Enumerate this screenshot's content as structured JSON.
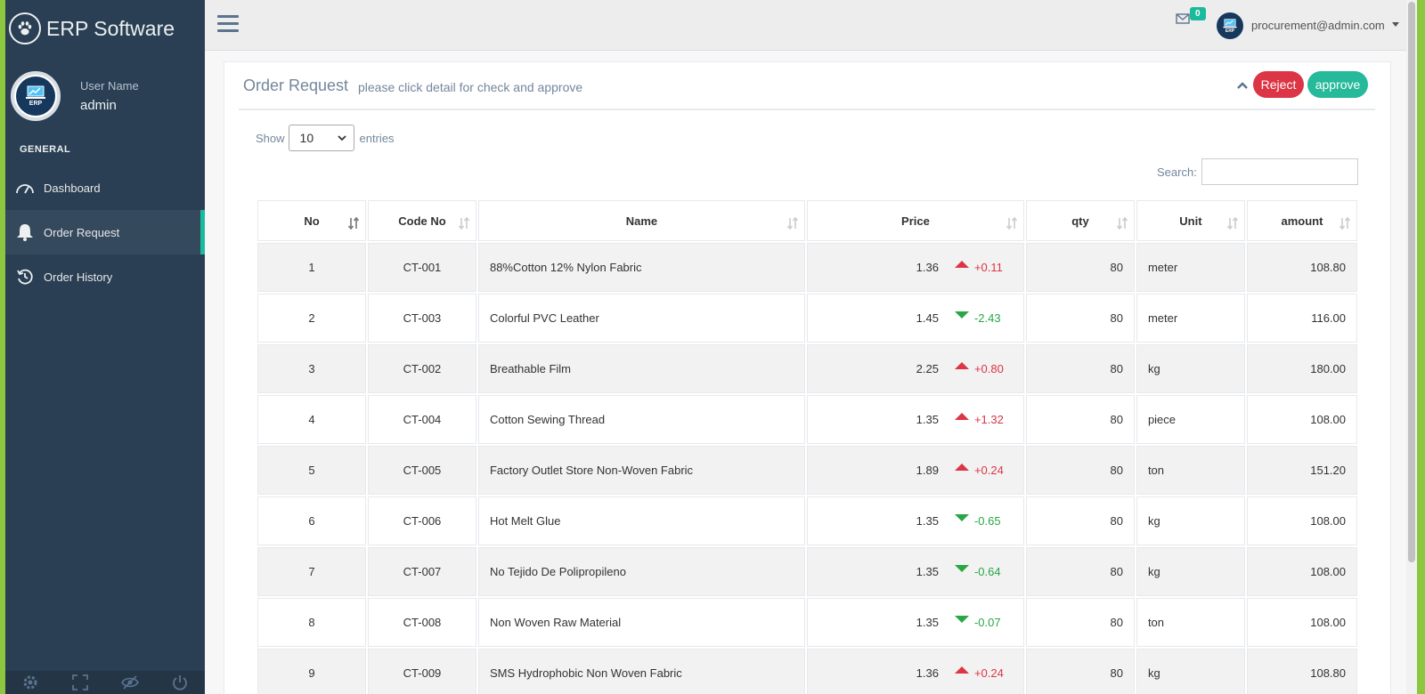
{
  "brand": {
    "title": "ERP Software",
    "icon": "paw-icon"
  },
  "profile": {
    "label": "User Name",
    "name": "admin",
    "avatar_text": "ERP"
  },
  "sidebar": {
    "section": "GENERAL",
    "items": [
      {
        "label": "Dashboard",
        "icon": "speedometer-icon",
        "active": false
      },
      {
        "label": "Order Request",
        "icon": "bell-icon",
        "active": true
      },
      {
        "label": "Order History",
        "icon": "history-icon",
        "active": false
      }
    ],
    "footer_icons": [
      "settings-icon",
      "fullscreen-icon",
      "lock-icon",
      "logout-icon"
    ]
  },
  "topnav": {
    "mail_count": "0",
    "user_email": "procurement@admin.com",
    "avatar_text": "ERP"
  },
  "panel": {
    "title": "Order Request",
    "subtitle": "please click detail for check and approve",
    "reject_label": "Reject",
    "approve_label": "approve"
  },
  "datatable": {
    "show_label": "Show",
    "entries_value": "10",
    "entries_label": "entries",
    "search_label": "Search:",
    "columns": [
      "No",
      "Code No",
      "Name",
      "Price",
      "qty",
      "Unit",
      "amount"
    ],
    "rows": [
      {
        "no": "1",
        "code": "CT-001",
        "name": "88%Cotton 12% Nylon Fabric",
        "price": "1.36",
        "delta": "+0.11",
        "dir": "up",
        "qty": "80",
        "unit": "meter",
        "amount": "108.80"
      },
      {
        "no": "2",
        "code": "CT-003",
        "name": "Colorful PVC Leather",
        "price": "1.45",
        "delta": "-2.43",
        "dir": "down",
        "qty": "80",
        "unit": "meter",
        "amount": "116.00"
      },
      {
        "no": "3",
        "code": "CT-002",
        "name": "Breathable Film",
        "price": "2.25",
        "delta": "+0.80",
        "dir": "up",
        "qty": "80",
        "unit": "kg",
        "amount": "180.00"
      },
      {
        "no": "4",
        "code": "CT-004",
        "name": "Cotton Sewing Thread",
        "price": "1.35",
        "delta": "+1.32",
        "dir": "up",
        "qty": "80",
        "unit": "piece",
        "amount": "108.00"
      },
      {
        "no": "5",
        "code": "CT-005",
        "name": "Factory Outlet Store Non-Woven Fabric",
        "price": "1.89",
        "delta": "+0.24",
        "dir": "up",
        "qty": "80",
        "unit": "ton",
        "amount": "151.20"
      },
      {
        "no": "6",
        "code": "CT-006",
        "name": "Hot Melt Glue",
        "price": "1.35",
        "delta": "-0.65",
        "dir": "down",
        "qty": "80",
        "unit": "kg",
        "amount": "108.00"
      },
      {
        "no": "7",
        "code": "CT-007",
        "name": "No Tejido De Polipropileno",
        "price": "1.35",
        "delta": "-0.64",
        "dir": "down",
        "qty": "80",
        "unit": "kg",
        "amount": "108.00"
      },
      {
        "no": "8",
        "code": "CT-008",
        "name": "Non Woven Raw Material",
        "price": "1.35",
        "delta": "-0.07",
        "dir": "down",
        "qty": "80",
        "unit": "ton",
        "amount": "108.00"
      },
      {
        "no": "9",
        "code": "CT-009",
        "name": "SMS Hydrophobic Non Woven Fabric",
        "price": "1.36",
        "delta": "+0.24",
        "dir": "up",
        "qty": "80",
        "unit": "kg",
        "amount": "108.80"
      }
    ]
  },
  "colors": {
    "sidebar_bg": "#2a3f54",
    "accent_green": "#1abb9c",
    "frame_green": "#8dc63f",
    "reject_red": "#dc3545",
    "approve_teal": "#26b99a",
    "up_red": "#dc3545",
    "down_green": "#28a745"
  }
}
